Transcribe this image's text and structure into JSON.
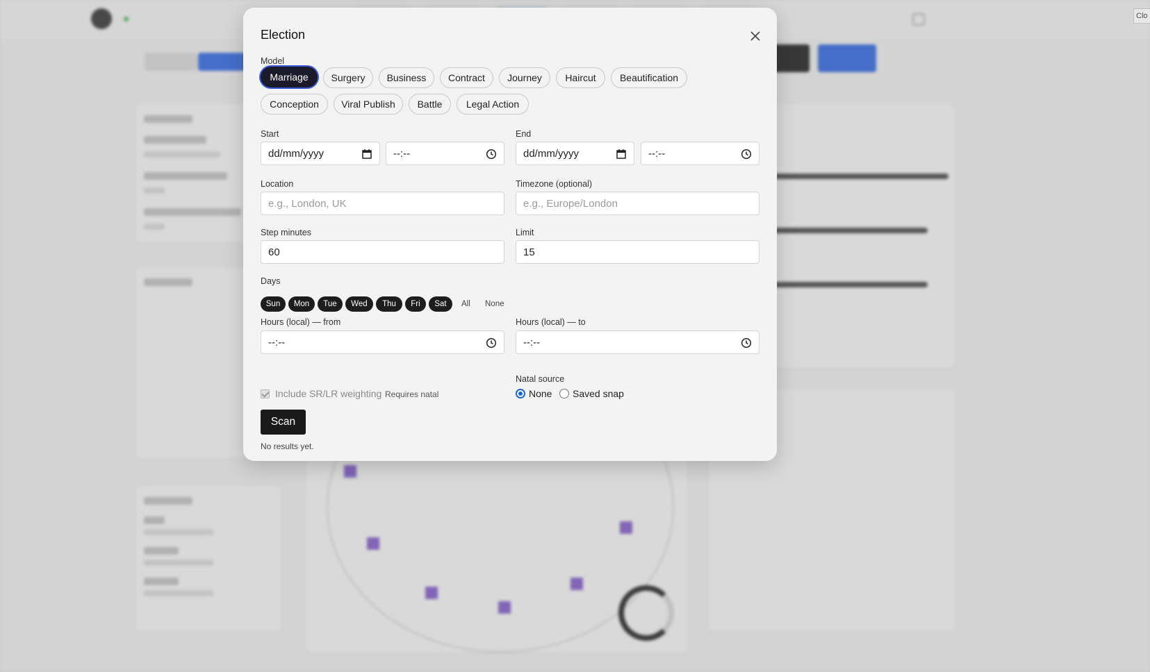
{
  "background": {
    "close_label": "Clo"
  },
  "modal": {
    "title": "Election",
    "model_label": "Model",
    "models": [
      {
        "label": "Marriage",
        "active": true
      },
      {
        "label": "Surgery"
      },
      {
        "label": "Business"
      },
      {
        "label": "Contract"
      },
      {
        "label": "Journey"
      },
      {
        "label": "Haircut"
      },
      {
        "label": "Beautification"
      },
      {
        "label": "Conception"
      },
      {
        "label": "Viral Publish"
      },
      {
        "label": "Battle"
      },
      {
        "label": "Legal Action"
      }
    ],
    "start_label": "Start",
    "end_label": "End",
    "date_placeholder": "dd/mm/yyyy",
    "time_placeholder": "--:--",
    "location_label": "Location",
    "location_placeholder": "e.g., London, UK",
    "timezone_label": "Timezone (optional)",
    "timezone_placeholder": "e.g., Europe/London",
    "step_label": "Step minutes",
    "step_value": "60",
    "limit_label": "Limit",
    "limit_value": "15",
    "days_label": "Days",
    "days": [
      "Sun",
      "Mon",
      "Tue",
      "Wed",
      "Thu",
      "Fri",
      "Sat"
    ],
    "days_all": "All",
    "days_none": "None",
    "hours_from_label": "Hours (local) — from",
    "hours_to_label": "Hours (local) — to",
    "weighting_label": "Include SR/LR weighting",
    "weighting_note": "Requires natal",
    "weighting_checked": true,
    "natal_label": "Natal source",
    "natal_options": [
      "None",
      "Saved snap"
    ],
    "natal_selected": "None",
    "scan_label": "Scan",
    "results_text": "No results yet."
  },
  "colors": {
    "active_pill": "#1b1b2b",
    "focus_ring": "#3b5bdb",
    "radio": "#1a66d9",
    "scan_button": "#1a1a1a"
  }
}
